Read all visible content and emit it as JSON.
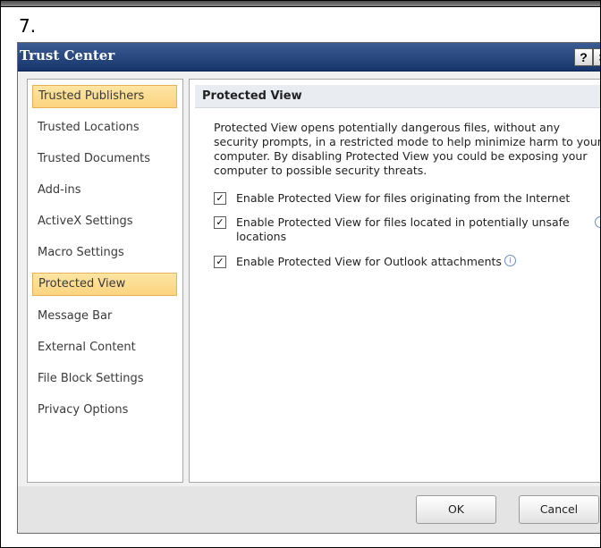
{
  "step": {
    "number": "7."
  },
  "dialog": {
    "title": "Trust Center",
    "help_glyph": "?",
    "close_glyph": "×"
  },
  "sidebar": {
    "items": [
      {
        "label": "Trusted Publishers",
        "selected": true
      },
      {
        "label": "Trusted Locations",
        "selected": false
      },
      {
        "label": "Trusted Documents",
        "selected": false
      },
      {
        "label": "Add-ins",
        "selected": false
      },
      {
        "label": "ActiveX Settings",
        "selected": false
      },
      {
        "label": "Macro Settings",
        "selected": false
      },
      {
        "label": "Protected View",
        "selected": true
      },
      {
        "label": "Message Bar",
        "selected": false
      },
      {
        "label": "External Content",
        "selected": false
      },
      {
        "label": "File Block Settings",
        "selected": false
      },
      {
        "label": "Privacy Options",
        "selected": false
      }
    ]
  },
  "main": {
    "section_title": "Protected View",
    "description": "Protected View opens potentially dangerous files, without any security prompts, in a restricted mode to help minimize harm to your computer. By disabling Protected View you could be exposing your computer to possible security threats.",
    "options": [
      {
        "label": "Enable Protected View for files originating from the Internet",
        "checked": true,
        "info": false
      },
      {
        "label": "Enable Protected View for files located in potentially unsafe locations",
        "checked": true,
        "info": true
      },
      {
        "label": "Enable Protected View for Outlook attachments",
        "checked": true,
        "info": true
      }
    ],
    "check_glyph": "✓",
    "info_glyph": "i"
  },
  "footer": {
    "ok_label": "OK",
    "cancel_label": "Cancel"
  },
  "colors": {
    "titlebar": "#1f3f78",
    "selected_fill": "#fcd98a",
    "info_icon": "#4a76c0"
  }
}
